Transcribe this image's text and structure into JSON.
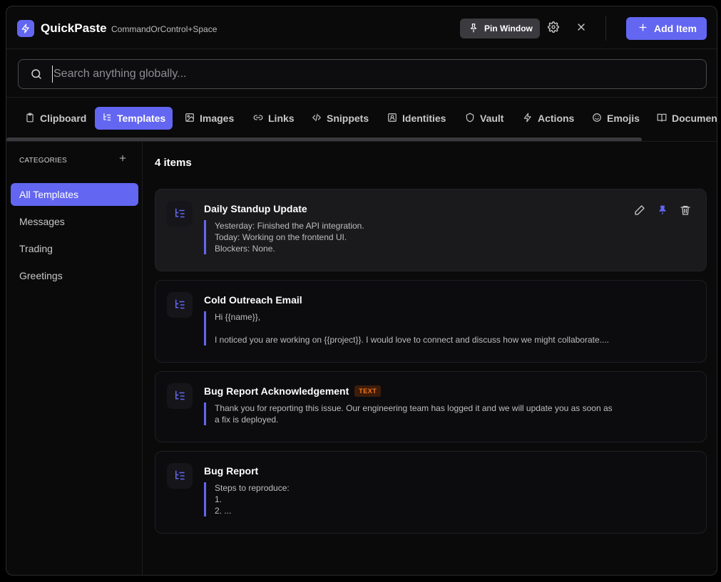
{
  "header": {
    "app_title": "QuickPaste",
    "shortcut": "CommandOrControl+Space",
    "pin_label": "Pin Window",
    "add_label": "Add Item"
  },
  "search": {
    "placeholder": "Search anything globally...",
    "value": ""
  },
  "tabs": [
    {
      "label": "Clipboard",
      "icon": "clipboard-icon",
      "active": false
    },
    {
      "label": "Templates",
      "icon": "templates-icon",
      "active": true
    },
    {
      "label": "Images",
      "icon": "image-icon",
      "active": false
    },
    {
      "label": "Links",
      "icon": "link-icon",
      "active": false
    },
    {
      "label": "Snippets",
      "icon": "code-icon",
      "active": false
    },
    {
      "label": "Identities",
      "icon": "id-card-icon",
      "active": false
    },
    {
      "label": "Vault",
      "icon": "shield-icon",
      "active": false
    },
    {
      "label": "Actions",
      "icon": "bolt-icon",
      "active": false
    },
    {
      "label": "Emojis",
      "icon": "smile-icon",
      "active": false
    },
    {
      "label": "Documents",
      "icon": "book-icon",
      "active": false
    }
  ],
  "sidebar": {
    "title": "CATEGORIES",
    "items": [
      {
        "label": "All Templates",
        "active": true
      },
      {
        "label": "Messages",
        "active": false
      },
      {
        "label": "Trading",
        "active": false
      },
      {
        "label": "Greetings",
        "active": false
      }
    ]
  },
  "main": {
    "count_label": "4 items",
    "cards": [
      {
        "title": "Daily Standup Update",
        "badge": "",
        "body": "Yesterday: Finished the API integration.\nToday: Working on the frontend UI.\nBlockers: None.",
        "hovered": true
      },
      {
        "title": "Cold Outreach Email",
        "badge": "",
        "body": "Hi {{name}},\n\nI noticed you are working on {{project}}. I would love to connect and discuss how we might collaborate....",
        "hovered": false
      },
      {
        "title": "Bug Report Acknowledgement",
        "badge": "TEXT",
        "body": "Thank you for reporting this issue. Our engineering team has logged it and we will update you as soon as a fix is deployed.",
        "hovered": false
      },
      {
        "title": "Bug Report",
        "badge": "",
        "body": "Steps to reproduce:\n1.\n2. ...",
        "hovered": false
      }
    ]
  },
  "colors": {
    "accent": "#6366f1",
    "background": "#0a0a0b",
    "card_hover": "#1a1a1d",
    "badge_text": "#f97316",
    "badge_bg": "#3d1d0a"
  }
}
